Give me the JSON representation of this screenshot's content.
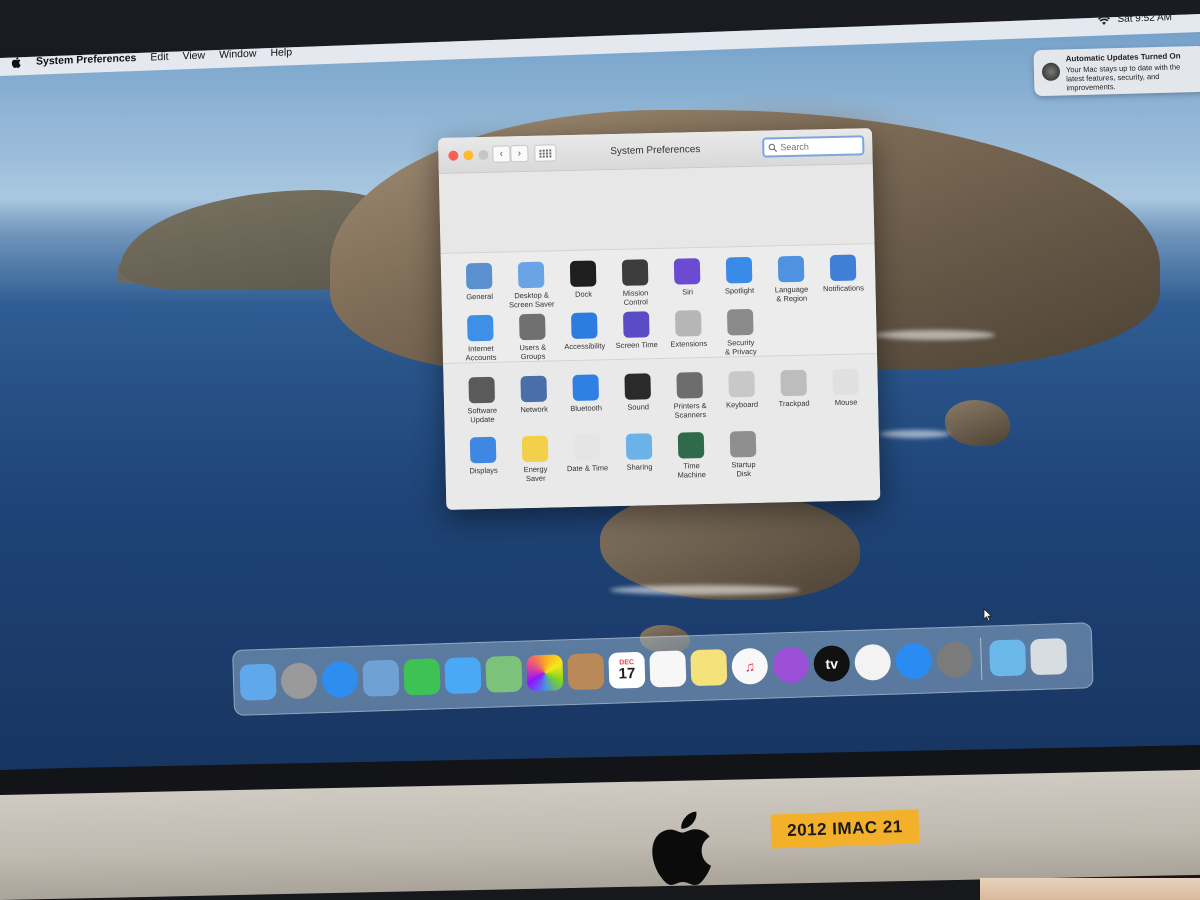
{
  "menubar": {
    "app_name": "System Preferences",
    "items": [
      "Edit",
      "View",
      "Window",
      "Help"
    ],
    "clock": "Sat 9:52 AM"
  },
  "notification": {
    "title": "Automatic Updates Turned On",
    "body": "Your Mac stays up to date with the latest features, security, and improvements."
  },
  "prefs_window": {
    "title": "System Preferences",
    "search_placeholder": "Search",
    "section1": [
      {
        "label": "General",
        "icon": "general-icon",
        "color": "#5a8fd0"
      },
      {
        "label": "Desktop &\nScreen Saver",
        "icon": "desktop-icon",
        "color": "#6aa3e6"
      },
      {
        "label": "Dock",
        "icon": "dock-icon",
        "color": "#1e1e1e"
      },
      {
        "label": "Mission\nControl",
        "icon": "mission-control-icon",
        "color": "#3c3c3c"
      },
      {
        "label": "Siri",
        "icon": "siri-icon",
        "color": "#6a4bd1"
      },
      {
        "label": "Spotlight",
        "icon": "spotlight-icon",
        "color": "#3a8be8"
      },
      {
        "label": "Language\n& Region",
        "icon": "flag-icon",
        "color": "#4e92e0"
      },
      {
        "label": "Notifications",
        "icon": "notifications-icon",
        "color": "#3f7fd6"
      },
      {
        "label": "Internet\nAccounts",
        "icon": "at-icon",
        "color": "#3d8fe8"
      },
      {
        "label": "Users &\nGroups",
        "icon": "users-icon",
        "color": "#707070"
      },
      {
        "label": "Accessibility",
        "icon": "accessibility-icon",
        "color": "#2d7de0"
      },
      {
        "label": "Screen Time",
        "icon": "hourglass-icon",
        "color": "#5b4bc4"
      },
      {
        "label": "Extensions",
        "icon": "puzzle-icon",
        "color": "#b6b6b6"
      },
      {
        "label": "Security\n& Privacy",
        "icon": "house-lock-icon",
        "color": "#8a8a8a"
      }
    ],
    "section2": [
      {
        "label": "Software\nUpdate",
        "icon": "gear-icon",
        "color": "#5a5a5a"
      },
      {
        "label": "Network",
        "icon": "globe-icon",
        "color": "#4a6fa8"
      },
      {
        "label": "Bluetooth",
        "icon": "bluetooth-icon",
        "color": "#2f7fe5"
      },
      {
        "label": "Sound",
        "icon": "speaker-icon",
        "color": "#2a2a2a"
      },
      {
        "label": "Printers &\nScanners",
        "icon": "printer-icon",
        "color": "#6d6d6d"
      },
      {
        "label": "Keyboard",
        "icon": "keyboard-icon",
        "color": "#c8c8c8"
      },
      {
        "label": "Trackpad",
        "icon": "trackpad-icon",
        "color": "#bdbdbd"
      },
      {
        "label": "Mouse",
        "icon": "mouse-icon",
        "color": "#e0e0e0"
      },
      {
        "label": "Displays",
        "icon": "display-icon",
        "color": "#3e88e4"
      },
      {
        "label": "Energy\nSaver",
        "icon": "bulb-icon",
        "color": "#f2d04a"
      },
      {
        "label": "Date & Time",
        "icon": "clock-icon",
        "color": "#e5e5e5"
      },
      {
        "label": "Sharing",
        "icon": "folder-sign-icon",
        "color": "#6ab2e8"
      },
      {
        "label": "Time\nMachine",
        "icon": "time-machine-icon",
        "color": "#2f6b4a"
      },
      {
        "label": "Startup\nDisk",
        "icon": "disk-icon",
        "color": "#8f8f8f"
      }
    ]
  },
  "dock": {
    "apps": [
      {
        "name": "finder-icon",
        "color": "#5fa8ec",
        "glyph": ""
      },
      {
        "name": "launchpad-icon",
        "color": "#9a9a9a",
        "glyph": ""
      },
      {
        "name": "safari-icon",
        "color": "#2d8ef0",
        "glyph": ""
      },
      {
        "name": "preview-icon",
        "color": "#6fa1d4",
        "glyph": ""
      },
      {
        "name": "facetime-icon",
        "color": "#3ec253",
        "glyph": ""
      },
      {
        "name": "messages-icon",
        "color": "#4aa8f5",
        "glyph": ""
      },
      {
        "name": "maps-icon",
        "color": "#7cc27a",
        "glyph": ""
      },
      {
        "name": "photos-icon",
        "color": "#f4f4f4",
        "glyph": ""
      },
      {
        "name": "contacts-icon",
        "color": "#b98a57",
        "glyph": ""
      },
      {
        "name": "calendar-icon",
        "color": "#ffffff",
        "glyph": "17",
        "month": "DEC"
      },
      {
        "name": "reminders-icon",
        "color": "#f7f7f7",
        "glyph": ""
      },
      {
        "name": "notes-icon",
        "color": "#f6e27a",
        "glyph": ""
      },
      {
        "name": "music-icon",
        "color": "#f8f8f8",
        "glyph": "♫"
      },
      {
        "name": "podcasts-icon",
        "color": "#9a4fd6",
        "glyph": ""
      },
      {
        "name": "tv-icon",
        "color": "#111111",
        "glyph": "tv"
      },
      {
        "name": "news-icon",
        "color": "#f3f3f3",
        "glyph": ""
      },
      {
        "name": "app-store-icon",
        "color": "#2a8cf2",
        "glyph": ""
      },
      {
        "name": "system-preferences-icon",
        "color": "#7b7b7b",
        "glyph": ""
      }
    ],
    "others": [
      {
        "name": "downloads-folder-icon",
        "color": "#6bb8ea"
      },
      {
        "name": "trash-icon",
        "color": "#d8dde2"
      }
    ]
  },
  "hardware": {
    "sticker": "2012 IMAC 21"
  }
}
